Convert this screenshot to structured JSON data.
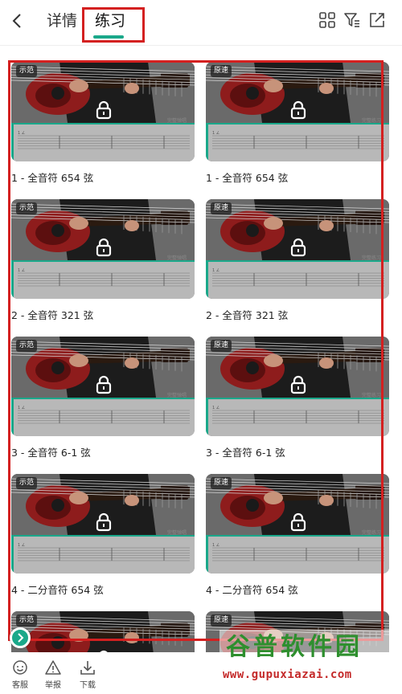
{
  "header": {
    "tabs": [
      {
        "label": "详情"
      },
      {
        "label": "练习"
      }
    ],
    "active_tab": "练习"
  },
  "cards": [
    {
      "badge": "示范",
      "title": "1 - 全音符 654 弦",
      "sheet_caption": "完整弹唱"
    },
    {
      "badge": "原速",
      "title": "1 - 全音符 654 弦",
      "sheet_caption": "完整练习"
    },
    {
      "badge": "示范",
      "title": "2 - 全音符 321 弦",
      "sheet_caption": "完整弹唱"
    },
    {
      "badge": "原速",
      "title": "2 - 全音符 321 弦",
      "sheet_caption": "完整练习"
    },
    {
      "badge": "示范",
      "title": "3 - 全音符 6-1 弦",
      "sheet_caption": "完整弹唱"
    },
    {
      "badge": "原速",
      "title": "3 - 全音符 6-1 弦",
      "sheet_caption": "完整练习"
    },
    {
      "badge": "示范",
      "title": "4 - 二分音符 654 弦",
      "sheet_caption": "完整弹唱"
    },
    {
      "badge": "原速",
      "title": "4 - 二分音符 654 弦",
      "sheet_caption": "完整练习"
    },
    {
      "badge": "示范",
      "title": "",
      "sheet_caption": ""
    },
    {
      "badge": "原速",
      "title": "",
      "sheet_caption": ""
    }
  ],
  "bottom_bar": {
    "service_label": "客服",
    "report_label": "举报",
    "download_label": "下载"
  },
  "watermark": {
    "title": "谷普软件园",
    "url": "www.gupuxiazai.com"
  },
  "colors": {
    "accent": "#1aa88a",
    "highlight": "#d42020"
  }
}
